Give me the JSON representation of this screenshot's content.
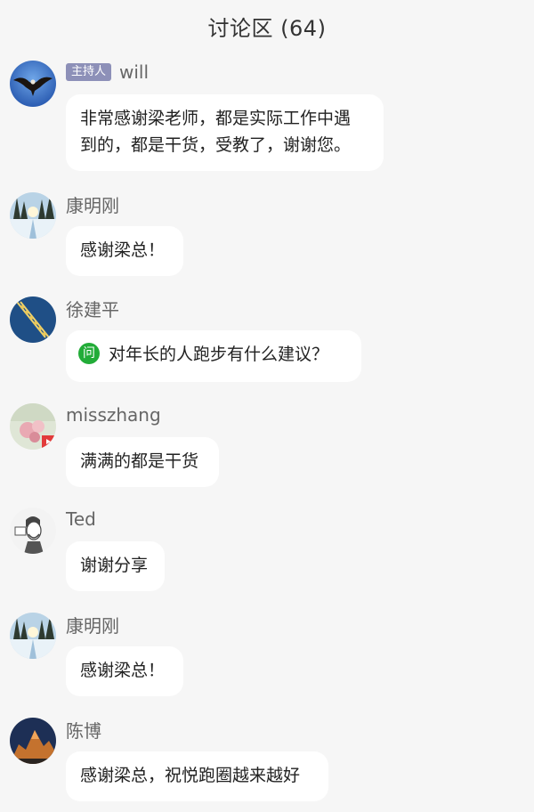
{
  "header": {
    "title": "讨论区 (64)"
  },
  "comments": [
    {
      "user": "will",
      "badge": "主持人",
      "avatar_icon": "eagle-avatar-icon",
      "lines": [
        "非常感谢梁老师，都是实际工作中遇",
        "到的，都是干货，受教了，谢谢您。"
      ]
    },
    {
      "user": "康明刚",
      "avatar_icon": "winter-forest-avatar-icon",
      "lines": [
        "感谢梁总！"
      ]
    },
    {
      "user": "徐建平",
      "avatar_icon": "rowing-avatar-icon",
      "question_icon_label": "问",
      "lines": [
        "对年长的人跑步有什么建议？"
      ]
    },
    {
      "user": "misszhang",
      "avatar_icon": "flowers-avatar-icon",
      "lines": [
        "满满的都是干货"
      ]
    },
    {
      "user": "Ted",
      "avatar_icon": "cartoon-portrait-avatar-icon",
      "lines": [
        "谢谢分享"
      ]
    },
    {
      "user": "康明刚",
      "avatar_icon": "winter-forest-avatar-icon",
      "lines": [
        "感谢梁总！"
      ]
    },
    {
      "user": "陈博",
      "avatar_icon": "mountain-avatar-icon",
      "lines": [
        "感谢梁总，祝悦跑圈越来越好"
      ]
    }
  ]
}
